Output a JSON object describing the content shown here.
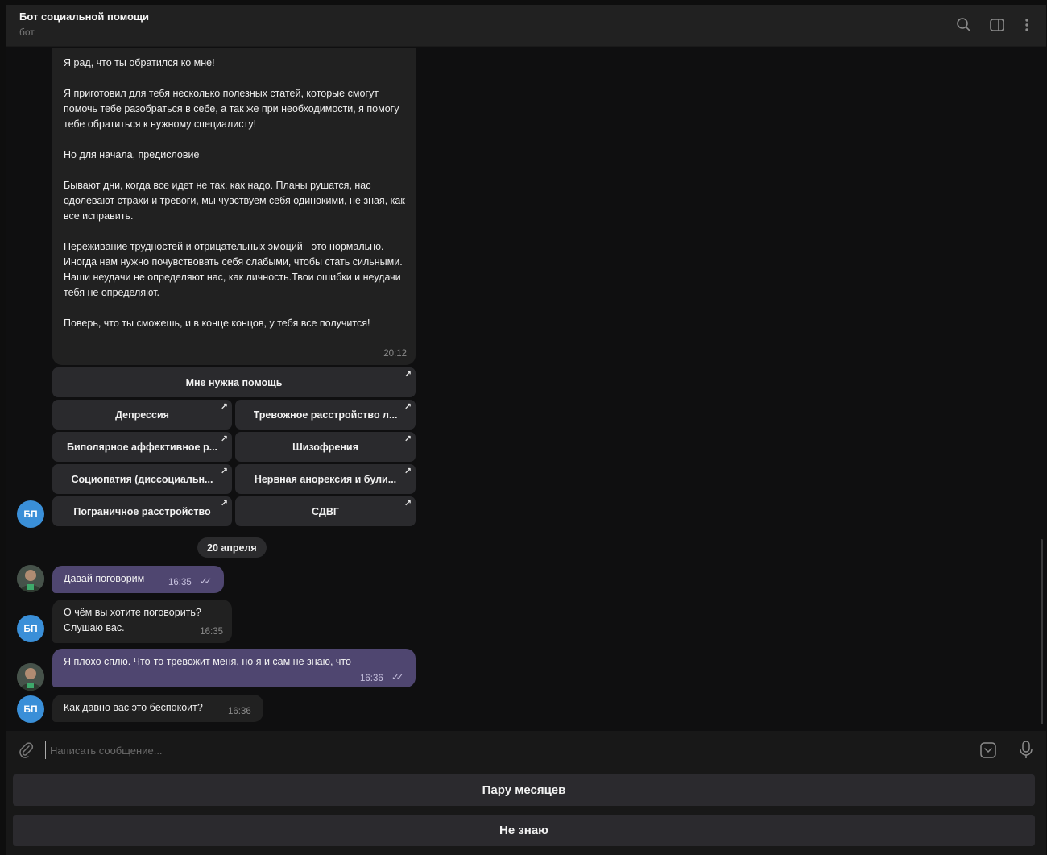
{
  "header": {
    "title": "Бот социальной помощи",
    "subtitle": "бот",
    "icons": [
      "search-icon",
      "sidebar-toggle-icon",
      "more-vertical-icon"
    ]
  },
  "messages": {
    "bot_long": {
      "text": "Я рад, что ты обратился ко мне!\n\nЯ приготовил для тебя несколько полезных статей, которые смогут помочь тебе разобраться в себе, а так же при необходимости, я помогу тебе обратиться к нужному специалисту!\n\nНо для начала, предисловие\n\nБывают дни, когда все идет не так, как надо. Планы рушатся, нас одолевают страхи и тревоги, мы чувствуем себя одинокими, не зная, как все исправить.\n\nПереживание трудностей и отрицательных эмоций - это нормально. Иногда нам нужно почувствовать себя слабыми, чтобы стать сильными. Наши неудачи не определяют нас, как личность.Твои ошибки и неудачи тебя не определяют.\n\nПоверь, что ты сможешь, и в конце концов, у тебя все получится!",
      "time": "20:12"
    },
    "inline_keyboard": {
      "help": "Мне нужна помощь",
      "depression": "Депрессия",
      "anxiety": "Тревожное расстройство л...",
      "bipolar": "Биполярное аффективное р...",
      "schizophrenia": "Шизофрения",
      "sociopathy": "Социопатия (диссоциальн...",
      "anorexia": "Нервная анорексия и були...",
      "borderline": "Пограничное расстройство",
      "adhd": "СДВГ",
      "arrow": "↗"
    },
    "date_separator": "20 апреля",
    "user_1": {
      "text": "Давай поговорим",
      "time": "16:35",
      "status": "✓✓"
    },
    "bot_1": {
      "text": "О чём вы хотите поговорить?\nСлушаю вас.",
      "time": "16:35"
    },
    "user_2": {
      "text": "Я плохо сплю. Что-то тревожит меня, но я и сам не знаю, что",
      "time": "16:36",
      "status": "✓✓"
    },
    "bot_2": {
      "text": "Как давно вас это беспокоит?",
      "time": "16:36"
    },
    "bot_avatar_initials": "БП"
  },
  "composer": {
    "placeholder": "Написать сообщение...",
    "icons": [
      "attach-icon",
      "keyboard-toggle-icon",
      "microphone-icon"
    ]
  },
  "reply_keyboard": {
    "option_1": "Пару месяцев",
    "option_2": "Не знаю"
  },
  "colors": {
    "incoming_bubble": "#212121",
    "outgoing_bubble": "#4f4670",
    "bot_avatar": "#3a8fd8",
    "background": "#0f0f10"
  }
}
